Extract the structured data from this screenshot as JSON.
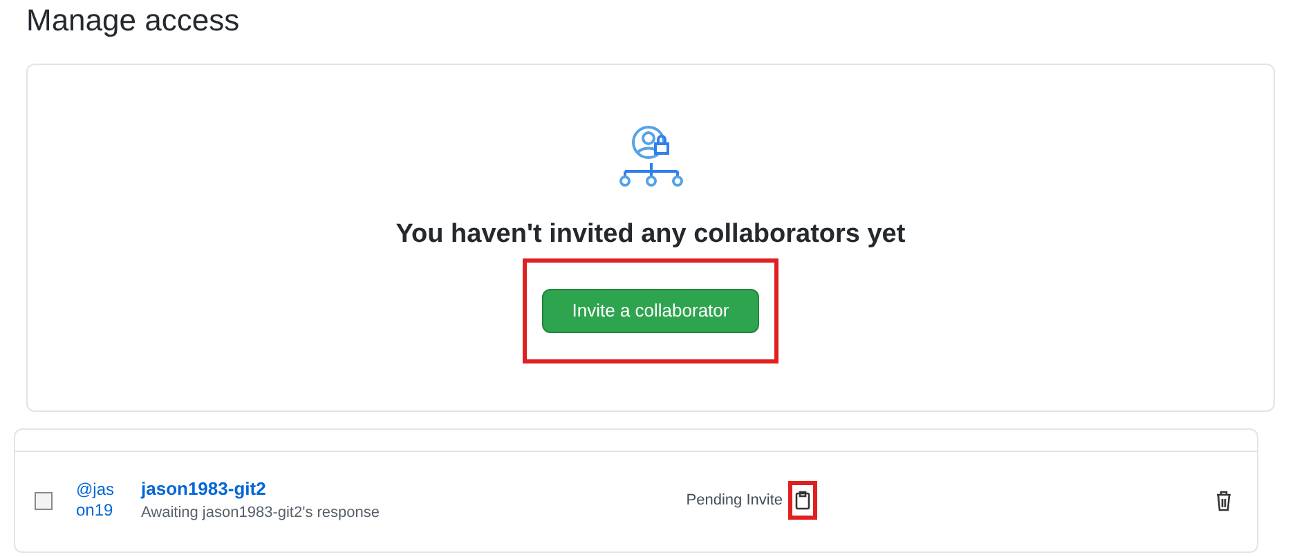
{
  "page_title": "Manage access",
  "empty_state": {
    "message": "You haven't invited any collaborators yet",
    "button": {
      "label": "Invite a collaborator",
      "highlighted": true
    }
  },
  "collaborators": [
    {
      "checked": false,
      "avatar_alt": "@jason19",
      "name": "jason1983-git2",
      "note": "Awaiting jason1983-git2's response",
      "status": "Pending Invite",
      "copy_highlighted": true
    }
  ]
}
